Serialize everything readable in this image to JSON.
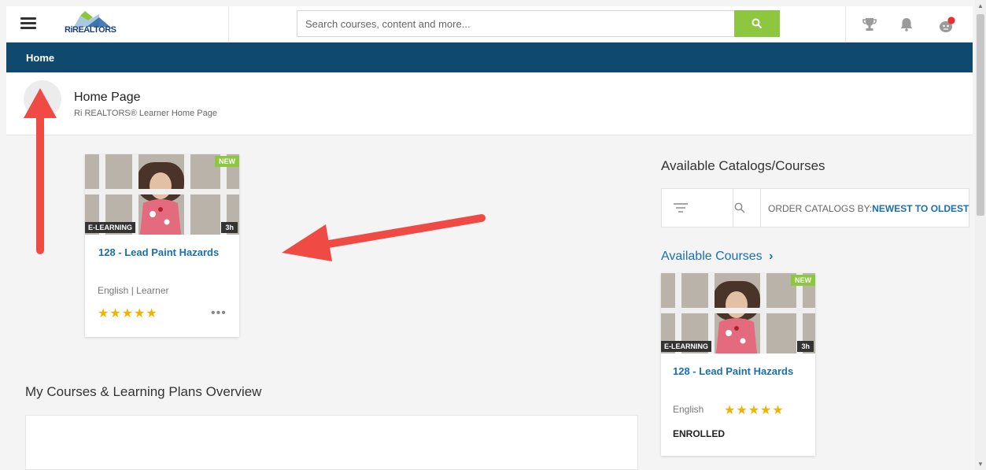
{
  "header": {
    "logo_text": "RiREALTORS",
    "search_placeholder": "Search courses, content and more...",
    "icons": [
      "menu-icon",
      "search-icon",
      "trophy-icon",
      "bell-icon",
      "avatar-icon"
    ],
    "accent_color": "#8dc63f",
    "notification_dot_color": "#e8312f"
  },
  "nav": {
    "home_label": "Home",
    "bar_color": "#0f4a6e"
  },
  "page": {
    "title": "Home Page",
    "subtitle": "Ri REALTORS® Learner Home Page"
  },
  "main_course": {
    "new_badge": "NEW",
    "type_badge": "E-LEARNING",
    "duration": "3h",
    "title": "128 - Lead Paint Hazards",
    "meta": "English | Learner",
    "stars": "★★★★★",
    "rating": 5,
    "more": "•••"
  },
  "overview": {
    "title": "My Courses & Learning Plans Overview"
  },
  "catalog": {
    "title": "Available Catalogs/Courses",
    "order_label": "ORDER CATALOGS BY:",
    "order_value": "NEWEST TO OLDEST",
    "available_link": "Available Courses",
    "course": {
      "new_badge": "NEW",
      "type_badge": "E-LEARNING",
      "duration": "3h",
      "title": "128 - Lead Paint Hazards",
      "language": "English",
      "stars": "★★★★★",
      "rating": 5,
      "status": "ENROLLED"
    }
  },
  "annotation_color": "#f04a45"
}
